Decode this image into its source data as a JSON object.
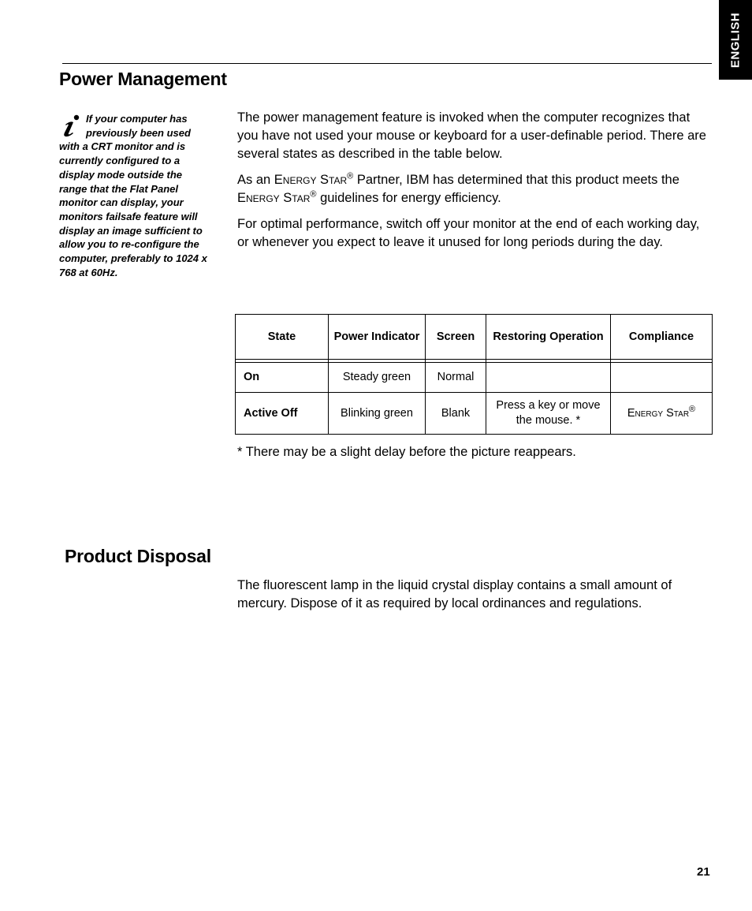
{
  "language_tab": "ENGLISH",
  "page_number": "21",
  "power_management": {
    "title": "Power Management",
    "note": "If your computer has previously been used with a CRT monitor and is currently configured to a display mode outside the range that the Flat Panel monitor can display, your monitors failsafe feature will display an image sufficient to allow you to re-configure the computer, preferably to 1024 x 768 at 60Hz.",
    "paragraph_1": "The power management feature is invoked when the computer recognizes that you have not used your mouse or keyboard for a user-definable period. There are several states as described in the table below.",
    "paragraph_2": {
      "prefix": "As an ",
      "brand": "Energy Star",
      "registered": "®",
      "middle": " Partner, IBM has determined that this product meets the ",
      "suffix": " guidelines for energy efficiency."
    },
    "paragraph_3": "For optimal performance, switch off your monitor at the end of each working day, or whenever you expect to leave it unused for long periods during the day.",
    "table": {
      "headers": [
        "State",
        "Power Indicator",
        "Screen",
        "Restoring Operation",
        "Compliance"
      ],
      "rows": [
        {
          "state": "On",
          "power_indicator": "Steady green",
          "screen": "Normal",
          "restoring_operation": "",
          "compliance": ""
        },
        {
          "state": "Active Off",
          "power_indicator": "Blinking green",
          "screen": "Blank",
          "restoring_operation": "Press a key or move the mouse. *",
          "compliance": "Energy Star",
          "compliance_mark": "®"
        }
      ]
    },
    "footnote": "* There may be a slight delay before the picture reappears."
  },
  "product_disposal": {
    "title": "Product Disposal",
    "paragraph": "The fluorescent lamp in the liquid crystal display contains a small amount of mercury. Dispose of it as required by local ordinances and regulations."
  }
}
